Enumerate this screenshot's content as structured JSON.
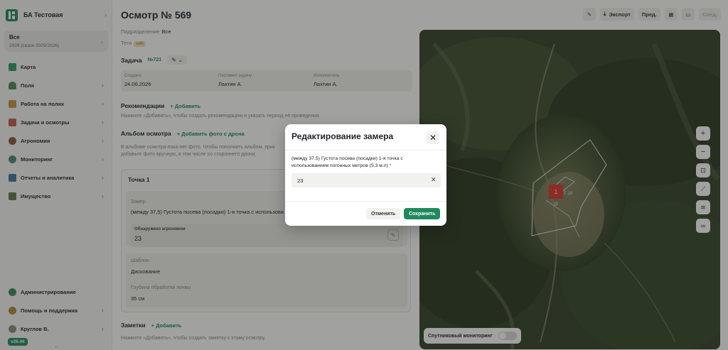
{
  "sidebar": {
    "org_name": "БА Тестовая",
    "season": {
      "title": "Все",
      "subtitle": "2026 (сезон 2025/2026)"
    },
    "items": [
      {
        "label": "Карта",
        "icon": "map-icon",
        "chevron": false
      },
      {
        "label": "Поля",
        "icon": "field-icon",
        "chevron": true
      },
      {
        "label": "Работа на полях",
        "icon": "tractor-icon",
        "chevron": true
      },
      {
        "label": "Задачи и осмотры",
        "icon": "tasks-icon",
        "chevron": true
      },
      {
        "label": "Агрономия",
        "icon": "agronomy-icon",
        "chevron": true
      },
      {
        "label": "Мониторинг",
        "icon": "monitoring-icon",
        "chevron": true
      },
      {
        "label": "Отчеты и аналитика",
        "icon": "reports-icon",
        "chevron": true
      },
      {
        "label": "Имущество",
        "icon": "property-icon",
        "chevron": true
      }
    ],
    "bottom": [
      {
        "label": "Администрирование",
        "icon": "admin-icon"
      },
      {
        "label": "Помощь и поддержка",
        "icon": "help-icon"
      },
      {
        "label": "Круглов В.",
        "icon": "avatar"
      }
    ],
    "version": "v26.06",
    "collapse_glyph": "←"
  },
  "header": {
    "title": "Осмотр № 569",
    "toolbar": {
      "export": "Экспорт",
      "prev": "Пред.",
      "next": "След."
    }
  },
  "info": {
    "division_label": "Подразделение",
    "division_value": "Все",
    "tags_label": "Теги",
    "tag_value": "with"
  },
  "task": {
    "heading": "Задача",
    "number": "№721",
    "columns": [
      {
        "key": "Создано",
        "value": "24.06.2026"
      },
      {
        "key": "Поставил задачу",
        "value": "Лахтин А."
      },
      {
        "key": "Исполнитель",
        "value": "Лахтин А."
      }
    ]
  },
  "recommendations": {
    "heading": "Рекомендации",
    "add": "Добавить",
    "hint": "Нажмите «Добавить», чтобы создать рекомендацию и указать период её проведения"
  },
  "album": {
    "heading": "Альбом осмотра",
    "add": "Добавить фото с дрона",
    "hint1": "В альбоме осмотра пока нет фото. Чтобы пополнить альбом, прик",
    "hint2": "добавьте фото вручную, в том числе со стороннего дрона"
  },
  "point": {
    "title": "Точка 1",
    "measure_label": "Замер",
    "measure_value": "(между 37,5) Густота посева (посадки) 1-я точка с использова",
    "found_label": "Обнаружено агрономом",
    "found_value": "23",
    "template_label": "Шаблон",
    "template_value": "Дискование",
    "depth_label": "Глубина обработки почвы",
    "depth_value": "35 см"
  },
  "notes": {
    "heading": "Заметки",
    "add": "Добавить",
    "hint": "Нажмите «Добавить», чтобы создать заметку к этому осмотру."
  },
  "map": {
    "marker_label": "1",
    "field_label": "Т 10",
    "satellite_label": "Спутниковый мониторинг",
    "zoom_in": "+",
    "zoom_out": "−"
  },
  "modal": {
    "title": "Редактирование замера",
    "label": "(между 37,5) Густота посева (посадки) 1-я точка с использованием погонных метров (5,3 м.п)",
    "required_mark": "*",
    "input_value": "23",
    "cancel": "Отменить",
    "save": "Сохранить"
  },
  "colors": {
    "accent": "#1f8a5e",
    "marker": "#d7372c"
  }
}
